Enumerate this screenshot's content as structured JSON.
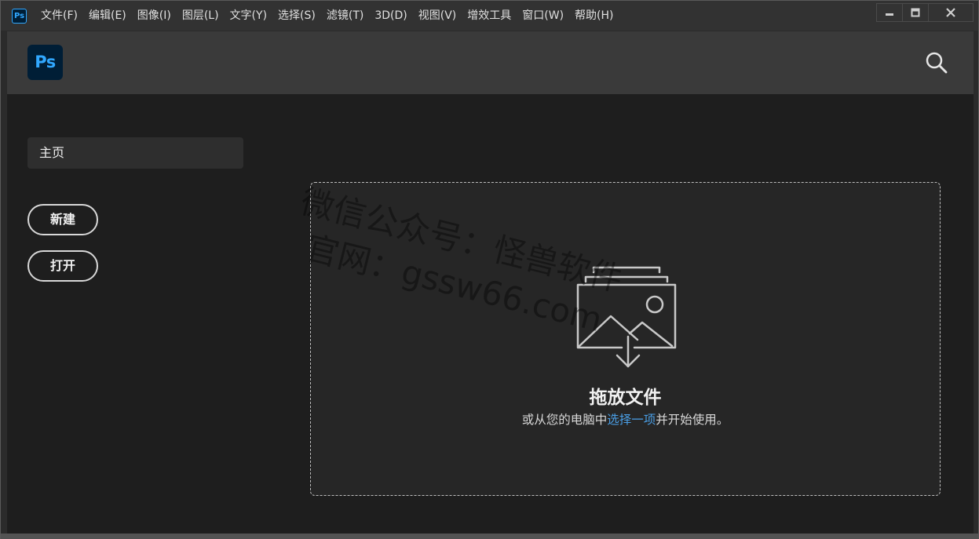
{
  "app": {
    "icon_text": "Ps",
    "brand_color": "#31a8ff",
    "brand_bg": "#001e36"
  },
  "menu": {
    "items": [
      "文件(F)",
      "编辑(E)",
      "图像(I)",
      "图层(L)",
      "文字(Y)",
      "选择(S)",
      "滤镜(T)",
      "3D(D)",
      "视图(V)",
      "增效工具",
      "窗口(W)",
      "帮助(H)"
    ]
  },
  "window_controls": {
    "icons": [
      "minimize-icon",
      "maximize-icon",
      "close-icon"
    ]
  },
  "header": {
    "logo_text": "Ps",
    "search_icon": "search-icon"
  },
  "sidebar": {
    "home_label": "主页",
    "new_label": "新建",
    "open_label": "打开"
  },
  "dropzone": {
    "icon": "image-stack-download-icon",
    "title": "拖放文件",
    "subtitle_prefix": "或从您的电脑中",
    "subtitle_link": "选择一项",
    "subtitle_suffix": "并开始使用。",
    "link_color": "#4a9fe6"
  },
  "watermark": {
    "line1": "微信公众号：怪兽软件",
    "line2": "官网：gssw66.com"
  }
}
